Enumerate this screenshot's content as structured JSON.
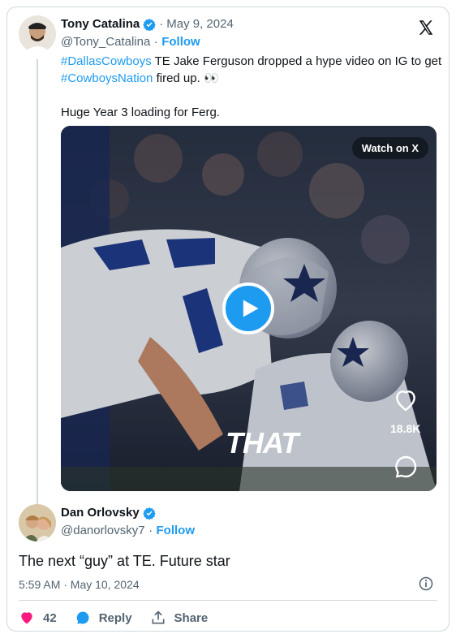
{
  "quoted_tweet": {
    "author_name": "Tony Catalina",
    "date": "May 9, 2024",
    "handle": "@Tony_Catalina",
    "separator": "·",
    "follow_label": "Follow",
    "text_hashtag_1": "#DallasCowboys",
    "text_part_1": " TE Jake Ferguson dropped a hype video on IG to get",
    "text_hashtag_2": "#CowboysNation",
    "text_part_2": " fired up. 👀",
    "text_line_3": "Huge Year 3 loading for Ferg.",
    "video": {
      "watch_label": "Watch on X",
      "like_count": "18.8K",
      "caption": "THAT"
    }
  },
  "tweet": {
    "author_name": "Dan Orlovsky",
    "handle": "@danorlovsky7",
    "separator": "·",
    "follow_label": "Follow",
    "text": "The next “guy” at TE. Future star",
    "timestamp": "5:59 AM · May 10, 2024"
  },
  "actions": {
    "like_count": "42",
    "reply_label": "Reply",
    "share_label": "Share"
  },
  "colors": {
    "accent": "#1d9bf0",
    "like": "#f91880",
    "text": "#0f1419",
    "muted": "#536471"
  },
  "icons": [
    "verified-icon",
    "x-logo-icon",
    "play-icon",
    "heart-icon",
    "comment-icon",
    "info-icon",
    "reply-icon",
    "share-icon"
  ]
}
